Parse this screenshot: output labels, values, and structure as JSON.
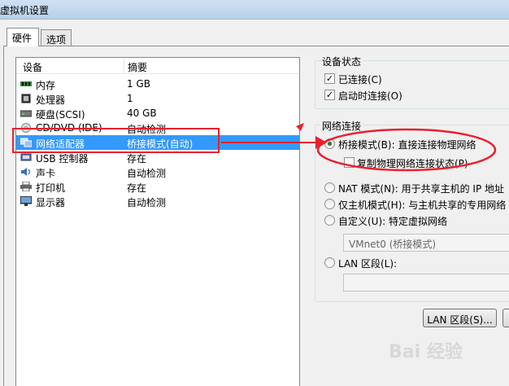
{
  "window": {
    "title": "虚拟机设置"
  },
  "tabs": [
    {
      "label": "硬件"
    },
    {
      "label": "选项"
    }
  ],
  "device_list": {
    "columns": [
      "设备",
      "摘要"
    ],
    "rows": [
      {
        "name": "内存",
        "summary": "1 GB",
        "icon": "memory-icon"
      },
      {
        "name": "处理器",
        "summary": "1",
        "icon": "cpu-icon"
      },
      {
        "name": "硬盘(SCSI)",
        "summary": "40 GB",
        "icon": "harddisk-icon"
      },
      {
        "name": "CD/DVD (IDE)",
        "summary": "自动检测",
        "icon": "cdrom-icon"
      },
      {
        "name": "网络适配器",
        "summary": "桥接模式(自动)",
        "icon": "network-adapter-icon",
        "selected": true
      },
      {
        "name": "USB 控制器",
        "summary": "存在",
        "icon": "usb-icon"
      },
      {
        "name": "声卡",
        "summary": "自动检测",
        "icon": "sound-icon"
      },
      {
        "name": "打印机",
        "summary": "存在",
        "icon": "printer-icon"
      },
      {
        "name": "显示器",
        "summary": "自动检测",
        "icon": "display-icon"
      }
    ]
  },
  "device_status": {
    "label": "设备状态",
    "connected": {
      "label": "已连接(C)",
      "checked": true
    },
    "connect_on_start": {
      "label": "启动时连接(O)",
      "checked": true
    }
  },
  "network_connection": {
    "label": "网络连接",
    "bridged": {
      "label": "桥接模式(B): 直接连接物理网络",
      "selected": true
    },
    "replicate": {
      "label": "复制物理网络连接状态(P)",
      "checked": false
    },
    "nat": {
      "label": "NAT 模式(N): 用于共享主机的 IP 地址"
    },
    "host_only": {
      "label": "仅主机模式(H): 与主机共享的专用网络"
    },
    "custom": {
      "label": "自定义(U): 特定虚拟网络"
    },
    "vmnet_select": "VMnet0 (桥接模式)",
    "lan_segment": {
      "label": "LAN 区段(L):"
    },
    "lan_button": "LAN 区段(S)..."
  },
  "watermark": "Bai 经验",
  "colors": {
    "selection": "#3399ff",
    "annotation": "#e8212f",
    "titlebar": "#b9d1ea"
  }
}
